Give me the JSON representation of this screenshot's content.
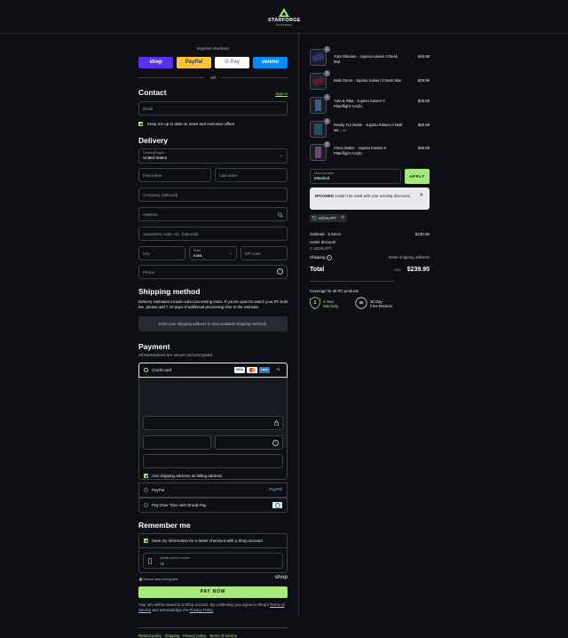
{
  "brand": {
    "name": "STARFORGE",
    "sub": "SYSTEMS"
  },
  "express": {
    "label": "Express checkout",
    "or": "OR",
    "shop": "shop",
    "paypal": "PayPal",
    "gpay": "G Pay",
    "venmo": "venmo"
  },
  "contact": {
    "title": "Contact",
    "signin": "Sign in",
    "email_ph": "Email",
    "news": "Keep me up to date on news and exclusive offers"
  },
  "delivery": {
    "title": "Delivery",
    "country_label": "Country/Region",
    "country": "United States",
    "first": "First name",
    "last": "Last name",
    "company": "Company (optional)",
    "address": "Address",
    "apt": "Apartment, suite, etc. (optional)",
    "city": "City",
    "state_label": "State",
    "state": "Iowa",
    "zip": "ZIP code",
    "phone": "Phone"
  },
  "shipping": {
    "title": "Shipping method",
    "note": "Delivery estimates include order processing times. If you've opted to watch your PC built live, please add 7-10 days of additional processing time to the estimate.",
    "box": "Enter your shipping address to view available shipping methods."
  },
  "payment": {
    "title": "Payment",
    "secure": "All transactions are secure and encrypted.",
    "credit": "Credit card",
    "more": "+5",
    "billing": "Use shipping address as billing address",
    "paypal": "PayPal",
    "paypal_logo": "PayPal",
    "bread": "Pay Over Time with Bread Pay"
  },
  "remember": {
    "title": "Remember me",
    "save": "Save my information for a faster checkout with a Shop account",
    "mobile_label": "Mobile phone number",
    "mobile_val": "+1",
    "secure": "Secure and encrypted",
    "shop": "shop"
  },
  "paynow": "PAY NOW",
  "legal": {
    "text": "Your info will be saved to a Shop account. By continuing, you agree to Shop's",
    "terms": "Terms of Service",
    "and": "and acknowledge the",
    "privacy": "Privacy Policy",
    "dot": "."
  },
  "footer": [
    "Refund policy",
    "Shipping",
    "Privacy policy",
    "Terms of service"
  ],
  "cart": {
    "items": [
      {
        "name": "Yuta Okkotsu - Jujutsu Kaisen 0 Desk Mat",
        "qty": "1",
        "price": "$49.99"
      },
      {
        "name": "Maki Zenin - Jujutsu Kaisen 0 Desk Mat",
        "qty": "1",
        "price": "$49.99"
      },
      {
        "name": "Yuta & Rika - Jujutsu Kaisen 0 Plateflight Acrylic",
        "qty": "1",
        "price": "$39.99"
      },
      {
        "name": "Ready For Battle - Jujutsu Kaisen 0 Wall Art",
        "sub": "11\" x 16\"",
        "qty": "1",
        "price": "$59.99"
      },
      {
        "name": "Class Mates - Jujutsu Kaisen 0 Plateflight Acrylic",
        "qty": "1",
        "price": "$39.99"
      }
    ]
  },
  "discount": {
    "label": "Discount code",
    "value": "Mtashed",
    "apply": "APPLY",
    "error_code": "MTASHED",
    "error": " couldn't be used with your existing discounts.",
    "tag": "SCHLATT"
  },
  "summary": {
    "subtotal_label": "Subtotal · 5 items",
    "subtotal": "$239.95",
    "order_discount": "Order discount",
    "discount_code": "SCHLATT",
    "shipping_label": "Shipping",
    "shipping_val": "Enter shipping address",
    "total_label": "Total",
    "currency": "USD",
    "total": "$239.95"
  },
  "coverage": {
    "title": "Coverage for all PC products",
    "warranty_num": "2",
    "warranty_line1": "2 Year",
    "warranty_line2": "Warranty",
    "returns_num": "30",
    "returns_line1": "30 Day",
    "returns_line2": "Free Returns"
  },
  "colors": {
    "accent": "#a6e87a",
    "bg": "#0d0f14"
  }
}
